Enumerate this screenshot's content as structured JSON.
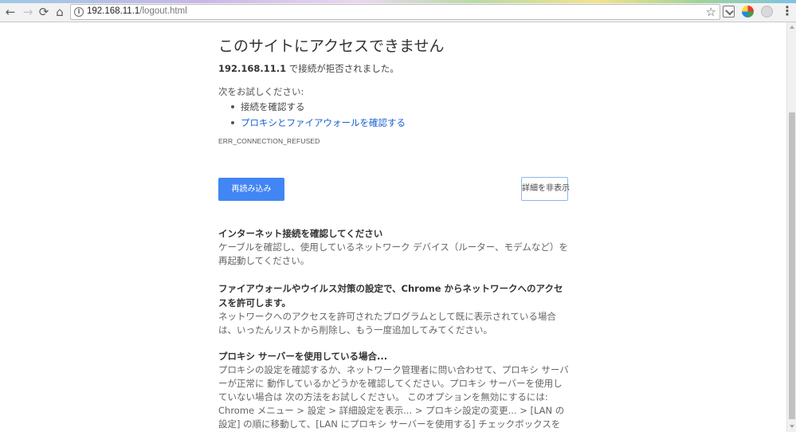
{
  "browser": {
    "url_host": "192.168.11.1",
    "url_path": "/logout.html",
    "icons": {
      "back": "arrow-left",
      "forward": "arrow-right",
      "reload": "reload",
      "home": "home",
      "info": "info-circle",
      "bookmark": "star",
      "menu": "vertical-dots"
    },
    "back_glyph": "←",
    "forward_glyph": "→",
    "reload_glyph": "⟳",
    "home_glyph": "⌂",
    "info_glyph": "i",
    "star_glyph": "☆",
    "menu_glyph": "⋮"
  },
  "error": {
    "title": "このサイトにアクセスできません",
    "host": "192.168.11.1",
    "summary_suffix": " で接続が拒否されました。",
    "suggest_heading": "次をお試しください:",
    "suggestions": [
      "接続を確認する",
      "プロキシとファイアウォールを確認する"
    ],
    "code": "ERR_CONNECTION_REFUSED",
    "reload_button": "再読み込み",
    "details_button": "詳細を非表示"
  },
  "details": {
    "sections": [
      {
        "heading": "インターネット接続を確認してください",
        "body": "ケーブルを確認し、使用しているネットワーク デバイス（ルーター、モデムなど）を 再起動してください。"
      },
      {
        "heading": "ファイアウォールやウイルス対策の設定で、Chrome からネットワークへのアクセスを許可します。",
        "body": "ネットワークへのアクセスを許可されたプログラムとして既に表示されている場合は、いったんリストから削除し、もう一度追加してみてください。"
      },
      {
        "heading": "プロキシ サーバーを使用している場合...",
        "body": "プロキシの設定を確認するか、ネットワーク管理者に問い合わせて、プロキシ サーバーが正常に 動作しているかどうかを確認してください。プロキシ サーバーを使用していない場合は 次の方法をお試しください。 このオプションを無効にするには: Chrome メニュー > 設定 > 詳細設定を表示... > プロキシ設定の変更... > [LAN の設定] の順に移動して、[LAN にプロキシ サーバーを使用する] チェックボックスをオフにします。"
      }
    ]
  },
  "colors": {
    "primary_button": "#4285f4",
    "link": "#1a5fd0",
    "details_border": "#8fb4ef"
  }
}
